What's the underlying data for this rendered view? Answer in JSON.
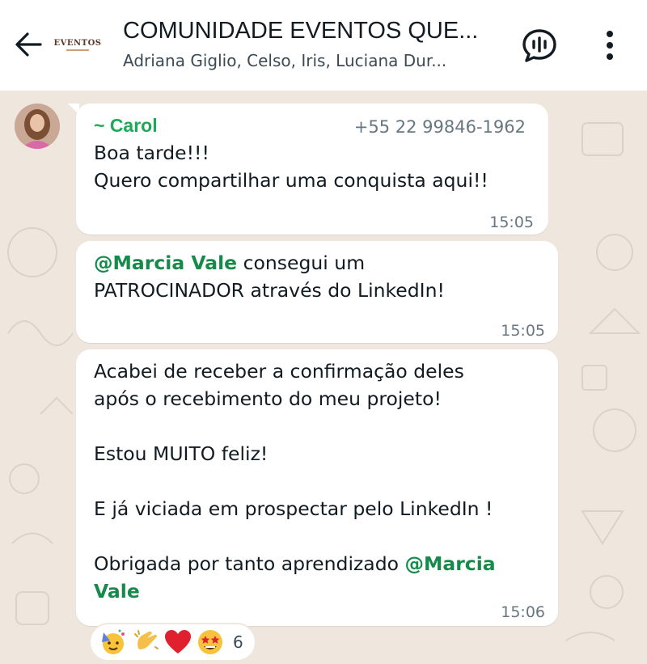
{
  "header": {
    "group_name": "COMUNIDADE EVENTOS QUE...",
    "members": "Adriana Giglio, Celso, Iris, Luciana Dur...",
    "logo_text": "EVENTOS"
  },
  "messages": [
    {
      "sender": "~ Carol",
      "phone": "+55 22 99846-1962",
      "text": "Boa tarde!!!\nQuero compartilhar uma conquista aqui!!",
      "time": "15:05"
    },
    {
      "mention": "@Marcia Vale",
      "text_after_mention": " consegui um\nPATROCINADOR através do LinkedIn!",
      "time": "15:05"
    },
    {
      "text": "Acabei de receber a confirmação deles\napós o recebimento do meu projeto!\n\nEstou MUITO feliz!\n\nE já viciada em prospectar pelo LinkedIn !\n\nObrigada por tanto aprendizado ",
      "mention_line1": "@Marcia",
      "mention_line2": "Vale",
      "time": "15:06"
    }
  ],
  "reactions": {
    "emojis": [
      "party-face-icon",
      "clapping-hands-icon",
      "red-heart-icon",
      "star-struck-icon"
    ],
    "count": "6"
  },
  "colors": {
    "accent_green": "#1fa855",
    "mention_green": "#168a4a",
    "wallpaper": "#efe7de",
    "bubble": "#ffffff"
  }
}
